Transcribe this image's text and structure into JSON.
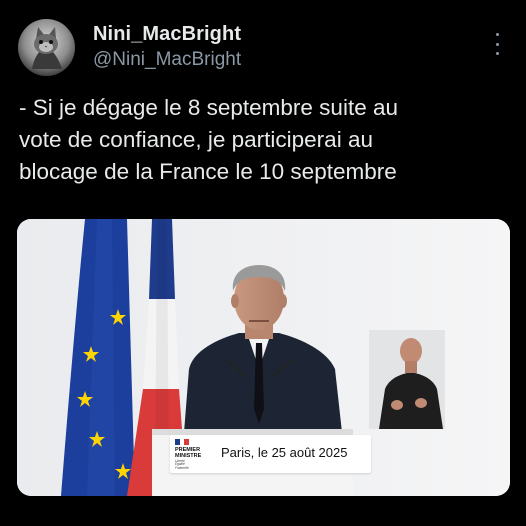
{
  "author": {
    "display_name": "Nini_MacBright",
    "handle": "@Nini_MacBright",
    "avatar_icon": "cat-avatar-icon"
  },
  "more_icon": "more-options-icon",
  "tweet": {
    "lines": [
      "- Si je dégage le 8 septembre suite au",
      "vote de confiance, je participerai au",
      "blocage de la France le 10 septembre"
    ]
  },
  "media": {
    "caption": "Paris, le 25 août 2025",
    "logo_lines": [
      "PREMIER",
      "MINISTRE"
    ],
    "logo_motto": [
      "Liberté",
      "Égalité",
      "Fraternité"
    ]
  },
  "colors": {
    "background": "#000000",
    "text_primary": "#e7e9ea",
    "text_secondary": "#8b98a5",
    "eu_blue": "#1c3f9e",
    "eu_star": "#ffd500",
    "fr_blue": "#1f3c8c",
    "fr_red": "#d93a3a",
    "suit": "#1d2535"
  }
}
